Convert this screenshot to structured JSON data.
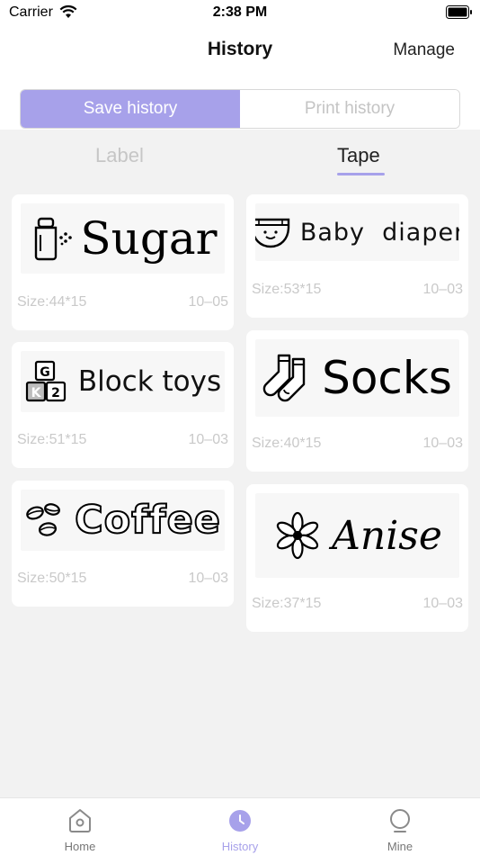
{
  "status_bar": {
    "carrier": "Carrier",
    "time": "2:38 PM",
    "icons": [
      "wifi-icon",
      "battery-icon"
    ]
  },
  "nav": {
    "title": "History",
    "manage_label": "Manage"
  },
  "segment": {
    "items": [
      "Save history",
      "Print history"
    ],
    "selected": "Save history"
  },
  "sub_tabs": {
    "items": [
      "Label",
      "Tape"
    ],
    "selected": "Tape"
  },
  "colors": {
    "accent": "#a7a1ea",
    "muted_text": "#c9c9c9",
    "background": "#f2f2f2"
  },
  "cards": [
    {
      "text": "Sugar",
      "icon": "salt-shaker-icon",
      "size": "Size:44*15",
      "date": "10–05"
    },
    {
      "text": "Baby  diaper",
      "icon": "diaper-icon",
      "size": "Size:53*15",
      "date": "10–03"
    },
    {
      "text": "Block toys",
      "icon": "toy-blocks-icon",
      "icon_letters": [
        "G",
        "K",
        "2"
      ],
      "size": "Size:51*15",
      "date": "10–03"
    },
    {
      "text": "Socks",
      "icon": "socks-icon",
      "size": "Size:40*15",
      "date": "10–03"
    },
    {
      "text": "Coffee",
      "icon": "coffee-beans-icon",
      "size": "Size:50*15",
      "date": "10–03"
    },
    {
      "text": "Anise",
      "icon": "star-anise-icon",
      "size": "Size:37*15",
      "date": "10–03"
    }
  ],
  "tab_bar": {
    "items": [
      {
        "label": "Home",
        "icon": "home-icon"
      },
      {
        "label": "History",
        "icon": "clock-icon"
      },
      {
        "label": "Mine",
        "icon": "user-icon"
      }
    ],
    "selected": "History"
  }
}
